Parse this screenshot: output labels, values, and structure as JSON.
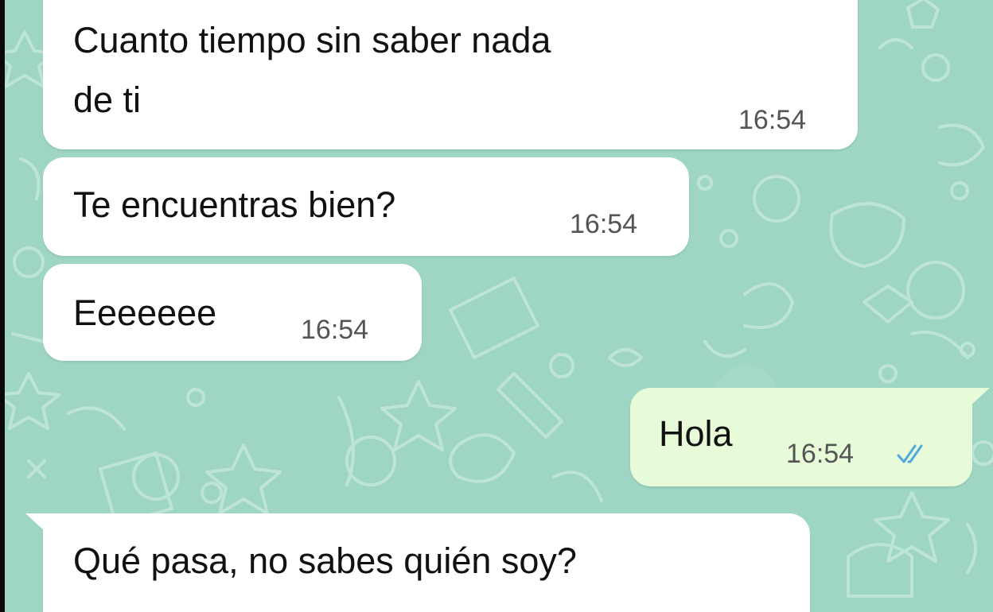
{
  "chat": {
    "messages": [
      {
        "direction": "incoming",
        "text_line1": "Cuanto tiempo sin saber nada",
        "text_line2": "de ti",
        "time": "16:54"
      },
      {
        "direction": "incoming",
        "text": "Te encuentras bien?",
        "time": "16:54"
      },
      {
        "direction": "incoming",
        "text": "Eeeeeee",
        "time": "16:54"
      },
      {
        "direction": "outgoing",
        "text": "Hola",
        "time": "16:54",
        "status_icon": "double-check-icon",
        "status_color": "#4fa9e0"
      },
      {
        "direction": "incoming",
        "text": "Qué pasa, no sabes quién soy?"
      }
    ]
  },
  "colors": {
    "wallpaper": "#9ed6c3",
    "incoming_bubble": "#ffffff",
    "outgoing_bubble": "#e8fbd9",
    "read_ticks": "#4fa9e0"
  }
}
